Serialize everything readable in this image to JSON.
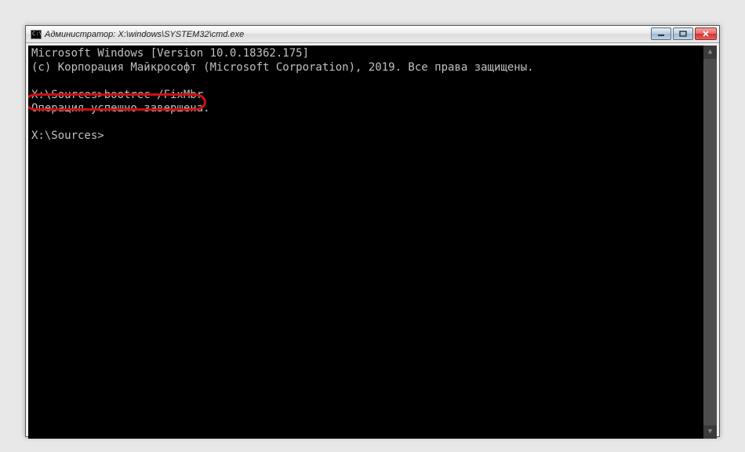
{
  "window": {
    "title": "Администратор: X:\\windows\\SYSTEM32\\cmd.exe",
    "icon_label": "C:\\"
  },
  "console": {
    "line1": "Microsoft Windows [Version 10.0.18362.175]",
    "line2": "(c) Корпорация Майкрософт (Microsoft Corporation), 2019. Все права защищены.",
    "blank1": " ",
    "prompt1": "X:\\Sources>bootrec /FixMbr",
    "result": "Операция успешно завершена.",
    "blank2": " ",
    "prompt2": "X:\\Sources>"
  },
  "scrollbar": {
    "up": "▲",
    "down": "▼"
  }
}
